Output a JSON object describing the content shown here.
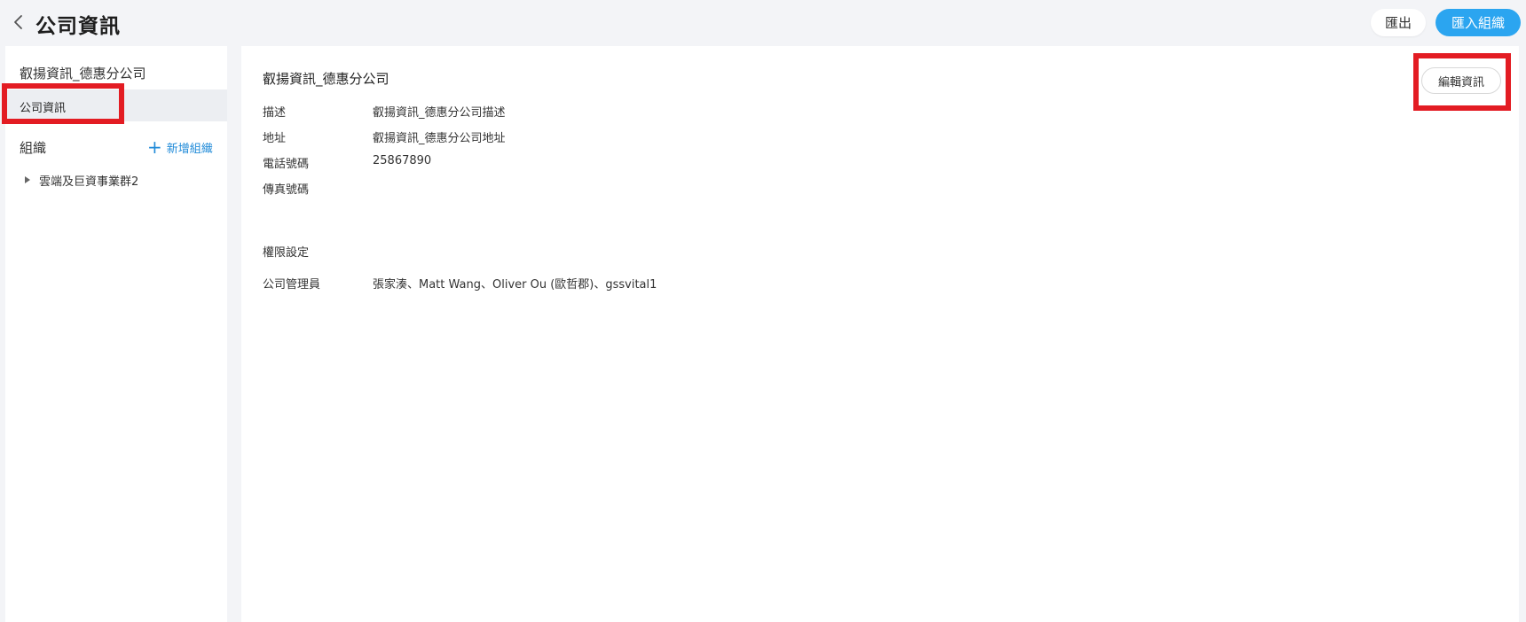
{
  "header": {
    "title": "公司資訊",
    "export_label": "匯出",
    "import_label": "匯入組織"
  },
  "sidebar": {
    "company_name": "叡揚資訊_德惠分公司",
    "nav_info_label": "公司資訊",
    "org_label": "組織",
    "add_org_label": "新增組織",
    "tree": [
      {
        "label": "雲端及巨資事業群2"
      }
    ]
  },
  "main": {
    "title": "叡揚資訊_德惠分公司",
    "edit_label": "編輯資訊",
    "fields": [
      {
        "key": "描述",
        "value": "叡揚資訊_德惠分公司描述"
      },
      {
        "key": "地址",
        "value": "叡揚資訊_德惠分公司地址"
      },
      {
        "key": "電話號碼",
        "value": "25867890"
      },
      {
        "key": "傳真號碼",
        "value": ""
      }
    ],
    "permissions_title": "權限設定",
    "admins_key": "公司管理員",
    "admins_value": "張家湊、Matt Wang、Oliver Ou (歐哲郡)、gssvital1"
  },
  "theme": {
    "accent": "#2ba5f0",
    "link": "#1f8ad8",
    "highlight": "#e31c23"
  }
}
